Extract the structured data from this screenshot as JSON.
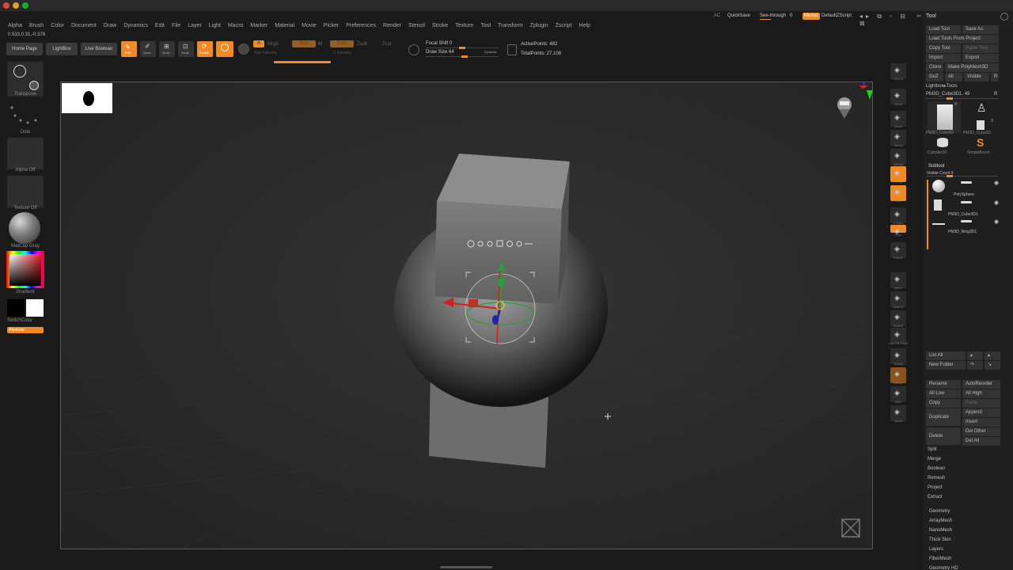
{
  "menu": [
    "Alpha",
    "Brush",
    "Color",
    "Document",
    "Draw",
    "Dynamics",
    "Edit",
    "File",
    "Layer",
    "Light",
    "Macro",
    "Marker",
    "Material",
    "Movie",
    "Picker",
    "Preferences",
    "Render",
    "Stencil",
    "Stroke",
    "Texture",
    "Tool",
    "Transform",
    "Zplugin",
    "Zscript",
    "Help"
  ],
  "coords": "0.533,0.31,-0.378",
  "topright": {
    "ac": "AC",
    "quicksave": "QuickSave",
    "seethrough": "See-through",
    "seethrough_val": "0",
    "menus": "Menus",
    "defaultzscript": "DefaultZScript"
  },
  "toolbar": {
    "home_page": "Home Page",
    "lightbox": "LightBox",
    "live_boolean": "Live Boolean",
    "edit": "Edit",
    "draw": "Draw",
    "move": "Move",
    "scale": "Scale",
    "rotate": "Rotate",
    "a": "A",
    "mrgb": "Mrgb",
    "rgb": "Rgb",
    "m": "M",
    "zadd": "Zadd",
    "zsub": "Zsub",
    "zcut": "Zcut",
    "rgb_intensity": "Rgb Intensity",
    "z_intensity": "Z Intensity",
    "focal_shift": "Focal Shift 0",
    "draw_size": "Draw Size 64",
    "dynamic": "Dynamic",
    "active_points": "ActivePoints: 482",
    "total_points": "TotalPoints: 27,108"
  },
  "left_panel": {
    "transpose": "Transpose",
    "dots": "Dots",
    "alpha_off": "Alpha Off",
    "texture_off": "Texture Off",
    "matcap": "MatCap Gray",
    "gradient": "Gradient",
    "switchcolor": "SwitchColor",
    "alternate": "Alternate"
  },
  "right_icons": [
    "SPix 3",
    "Scroll",
    "Zoom",
    "Actual",
    "AAHalf",
    "Persp",
    "Floor",
    "L.Sym",
    "Gxyz",
    "Frame",
    "Move",
    "ZoomD",
    "RotaTe",
    "Line Fill PolyF",
    "Transp",
    "Ghost",
    "Solo",
    "Xpose"
  ],
  "colors": {
    "accent": "#f08a24",
    "panel": "#1f1f1f",
    "button": "#333333"
  },
  "tool_panel": {
    "title": "Tool",
    "load_tool": "Load Tool",
    "save_as": "Save As",
    "load_tools_from_project": "Load Tools From Project",
    "copy_tool": "Copy Tool",
    "paste_tool": "Paste Tool",
    "import": "Import",
    "export": "Export",
    "clone": "Clone",
    "make_polymesh": "Make PolyMesh3D",
    "goz": "GoZ",
    "all": "All",
    "visible": "Visible",
    "r": "R",
    "lightbox_tools": "Lightbox▸Tools",
    "current_tool": "PM3D_Cube3D1. 49",
    "r2": "R",
    "thumb_labels": [
      "PM3D_Cube3D",
      "PM3D_Cube3D",
      "Cylinder3D",
      "SimpleBrush"
    ],
    "thumb_counts": [
      "3",
      "3"
    ],
    "subtool": "Subtool",
    "visible_count": "Visible Count 9",
    "subtools": [
      "PolySphere",
      "PM3D_Cube3D1",
      "PM3D_Ring3D1"
    ],
    "list_all": "List All",
    "new_folder": "New Folder",
    "rename": "Rename",
    "autoreorder": "AutoReorder",
    "all_low": "All Low",
    "all_high": "All High",
    "copy": "Copy",
    "paste": "Paste",
    "duplicate": "Duplicate",
    "append": "Append",
    "insert": "Insert",
    "delete": "Delete",
    "del_other": "Del Other",
    "del_all": "Del All",
    "sections": [
      "Split",
      "Merge",
      "Boolean",
      "Remesh",
      "Project",
      "Extract"
    ],
    "lower_sections": [
      "Geometry",
      "ArrayMesh",
      "NanoMesh",
      "Thick Skin",
      "Layers",
      "FiberMesh",
      "Geometry HD"
    ]
  }
}
